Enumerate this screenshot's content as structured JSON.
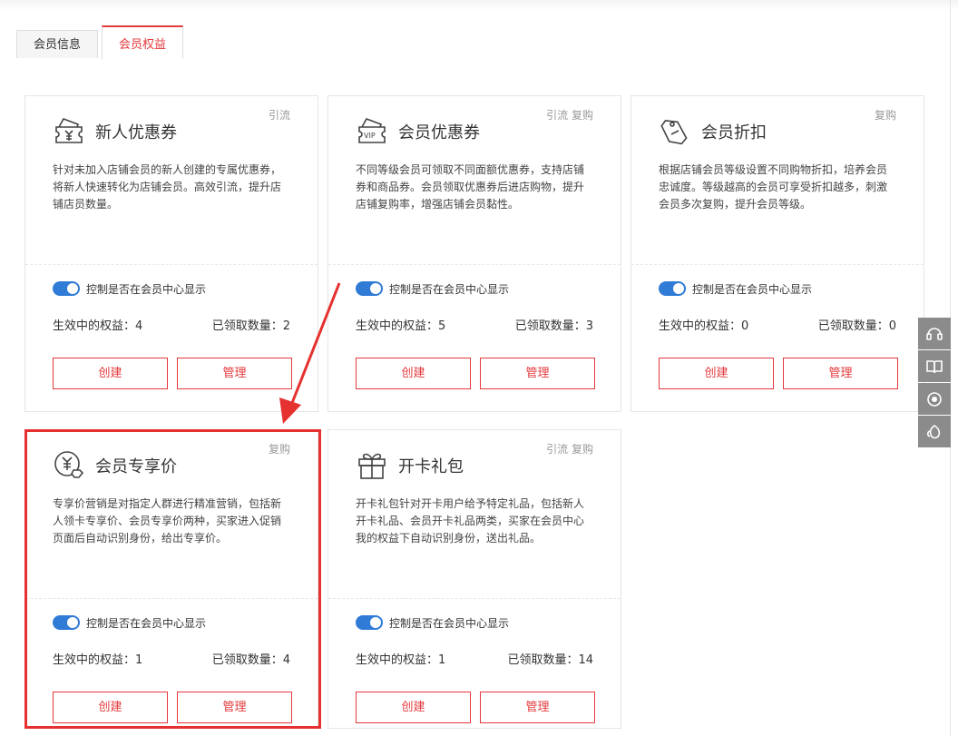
{
  "tabs": [
    {
      "label": "会员信息",
      "active": false
    },
    {
      "label": "会员权益",
      "active": true
    }
  ],
  "accent_color": "#e4393c",
  "toggle_color": "#2f7bd6",
  "cards": [
    {
      "icon": "ticket-yuan-icon",
      "title": "新人优惠券",
      "tag": "引流",
      "desc": "针对未加入店铺会员的新人创建的专属优惠券，将新人快速转化为店铺会员。高效引流，提升店铺店员数量。",
      "toggle_label": "控制是否在会员中心显示",
      "toggle_on": true,
      "active_label": "生效中的权益：4",
      "claimed_label": "已领取数量：2",
      "create_label": "创建",
      "manage_label": "管理"
    },
    {
      "icon": "ticket-vip-icon",
      "title": "会员优惠券",
      "tag": "引流 复购",
      "desc": "不同等级会员可领取不同面额优惠券，支持店铺券和商品券。会员领取优惠券后进店购物，提升店铺复购率，增强店铺会员黏性。",
      "toggle_label": "控制是否在会员中心显示",
      "toggle_on": true,
      "active_label": "生效中的权益：5",
      "claimed_label": "已领取数量：3",
      "create_label": "创建",
      "manage_label": "管理"
    },
    {
      "icon": "price-tag-icon",
      "title": "会员折扣",
      "tag": "复购",
      "desc": "根据店铺会员等级设置不同购物折扣，培养会员忠诚度。等级越高的会员可享受折扣越多，刺激会员多次复购，提升会员等级。",
      "toggle_label": "控制是否在会员中心显示",
      "toggle_on": true,
      "active_label": "生效中的权益：0",
      "claimed_label": "已领取数量：0",
      "create_label": "创建",
      "manage_label": "管理"
    },
    {
      "icon": "yuan-coin-icon",
      "title": "会员专享价",
      "tag": "复购",
      "desc": "专享价营销是对指定人群进行精准营销，包括新人领卡专享价、会员专享价两种，买家进入促销页面后自动识别身份，给出专享价。",
      "toggle_label": "控制是否在会员中心显示",
      "toggle_on": true,
      "active_label": "生效中的权益：1",
      "claimed_label": "已领取数量：4",
      "create_label": "创建",
      "manage_label": "管理"
    },
    {
      "icon": "gift-icon",
      "title": "开卡礼包",
      "tag": "引流 复购",
      "desc": "开卡礼包针对开卡用户给予特定礼品，包括新人开卡礼品、会员开卡礼品两类，买家在会员中心我的权益下自动识别身份，送出礼品。",
      "toggle_label": "控制是否在会员中心显示",
      "toggle_on": true,
      "active_label": "生效中的权益：1",
      "claimed_label": "已领取数量：14",
      "create_label": "创建",
      "manage_label": "管理"
    }
  ],
  "side_tools": [
    "headset-icon",
    "book-icon",
    "record-icon",
    "share-icon"
  ]
}
